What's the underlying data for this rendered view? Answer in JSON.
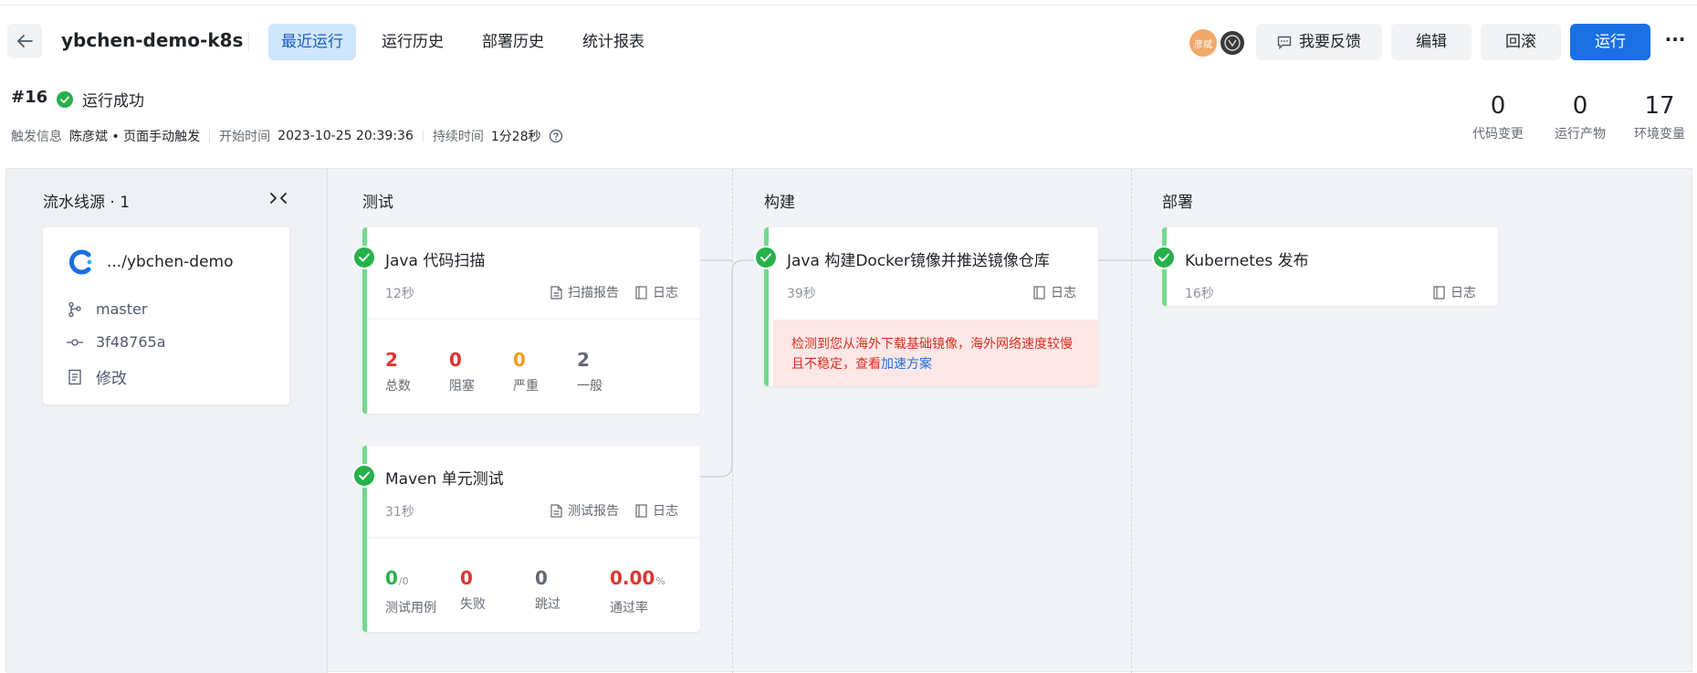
{
  "header": {
    "title": "ybchen-demo-k8s",
    "tabs": [
      "最近运行",
      "运行历史",
      "部署历史",
      "统计报表"
    ],
    "active_tab": 0,
    "avatar_text": "彦斌",
    "feedback_label": "我要反馈",
    "edit_label": "编辑",
    "rollback_label": "回滚",
    "run_label": "运行",
    "more_label": "···"
  },
  "run": {
    "number": "#16",
    "status": "运行成功",
    "trigger_label": "触发信息",
    "trigger_value": "陈彦斌 • 页面手动触发",
    "start_label": "开始时间",
    "start_value": "2023-10-25 20:39:36",
    "duration_label": "持续时间",
    "duration_value": "1分28秒"
  },
  "stats": [
    {
      "value": "0",
      "label": "代码变更"
    },
    {
      "value": "0",
      "label": "运行产物"
    },
    {
      "value": "17",
      "label": "环境变量"
    }
  ],
  "source": {
    "title": "流水线源 · 1",
    "repo": ".../ybchen-demo",
    "branch": "master",
    "commit": "3f48765a",
    "change": "修改"
  },
  "stages": [
    {
      "title": "测试",
      "jobs": [
        {
          "name": "Java 代码扫描",
          "time": "12秒",
          "links": [
            "扫描报告",
            "日志"
          ],
          "metrics": [
            {
              "value": "2",
              "label": "总数"
            },
            {
              "value": "0",
              "label": "阻塞"
            },
            {
              "value": "0",
              "label": "严重"
            },
            {
              "value": "2",
              "label": "一般"
            }
          ]
        },
        {
          "name": "Maven 单元测试",
          "time": "31秒",
          "links": [
            "测试报告",
            "日志"
          ],
          "metrics": [
            {
              "value": "0",
              "suffix": "/0",
              "label": "测试用例"
            },
            {
              "value": "0",
              "label": "失败"
            },
            {
              "value": "0",
              "label": "跳过"
            },
            {
              "value": "0.00",
              "suffix": "%",
              "label": "通过率"
            }
          ]
        }
      ]
    },
    {
      "title": "构建",
      "jobs": [
        {
          "name": "Java 构建Docker镜像并推送镜像仓库",
          "time": "39秒",
          "links": [
            "日志"
          ],
          "warning": "检测到您从海外下载基础镜像，海外网络速度较慢且不稳定，查看",
          "warning_link": "加速方案"
        }
      ]
    },
    {
      "title": "部署",
      "jobs": [
        {
          "name": "Kubernetes 发布",
          "time": "16秒",
          "links": [
            "日志"
          ]
        }
      ]
    }
  ],
  "colors": {
    "accent": "#1a6fe3",
    "success": "#26b24a",
    "error": "#e0342e",
    "warning": "#f59b23",
    "active_tab_bg": "#cfe6fd"
  }
}
